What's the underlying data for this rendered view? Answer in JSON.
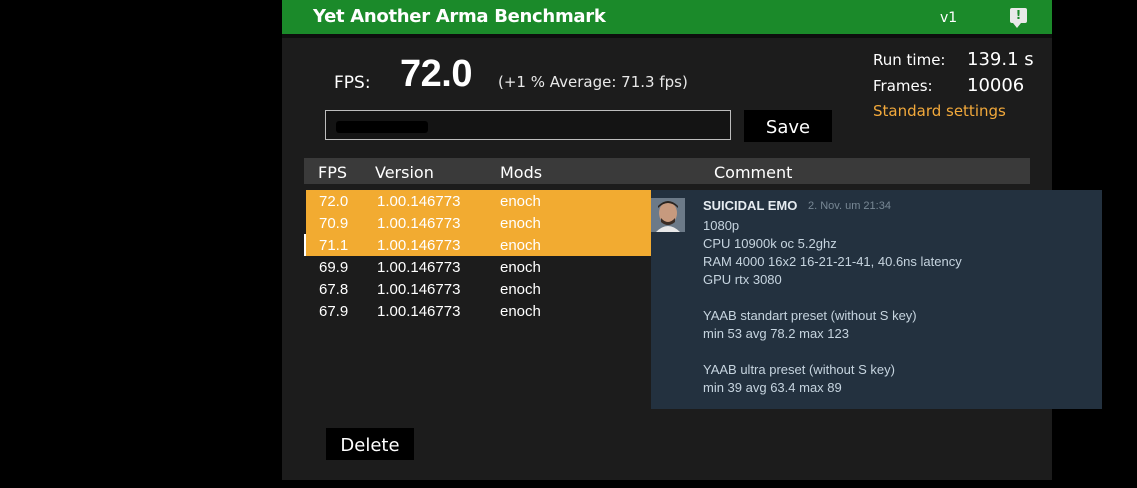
{
  "app": {
    "title": "Yet Another Arma Benchmark",
    "version": "v1",
    "info_icon": "info-icon"
  },
  "stats": {
    "fps_label": "FPS:",
    "fps_value": "72.0",
    "fps_average": "(+1 % Average: 71.3 fps)",
    "runtime_label": "Run time:",
    "runtime_value": "139.1 s",
    "frames_label": "Frames:",
    "frames_value": "10006",
    "settings_link": "Standard settings"
  },
  "comment_input": {
    "value": ""
  },
  "buttons": {
    "save": "Save",
    "delete": "Delete"
  },
  "table": {
    "headers": {
      "fps": "FPS",
      "version": "Version",
      "mods": "Mods",
      "comment": "Comment"
    },
    "rows": [
      {
        "fps": "72.0",
        "version": "1.00.146773",
        "mods": "enoch",
        "selected": true
      },
      {
        "fps": "70.9",
        "version": "1.00.146773",
        "mods": "enoch",
        "selected": true
      },
      {
        "fps": "71.1",
        "version": "1.00.146773",
        "mods": "enoch",
        "selected": true
      },
      {
        "fps": "69.9",
        "version": "1.00.146773",
        "mods": "enoch",
        "selected": false
      },
      {
        "fps": "67.8",
        "version": "1.00.146773",
        "mods": "enoch",
        "selected": false
      },
      {
        "fps": "67.9",
        "version": "1.00.146773",
        "mods": "enoch",
        "selected": false
      }
    ]
  },
  "tooltip": {
    "author": "SUICIDAL EMO",
    "date": "2. Nov. um 21:34",
    "lines": [
      "1080p",
      "CPU 10900k oc 5.2ghz",
      "RAM 4000 16x2 16-21-21-41, 40.6ns latency",
      "GPU rtx 3080",
      "",
      "YAAB standart preset (without S key)",
      "min 53 avg 78.2 max 123",
      "",
      "YAAB ultra preset (without S key)",
      "min 39 avg 63.4 max 89"
    ]
  },
  "colors": {
    "title_bar": "#1b8a2a",
    "selection": "#f2ab31",
    "link": "#f2a93b",
    "tooltip_bg": "#23313f"
  }
}
